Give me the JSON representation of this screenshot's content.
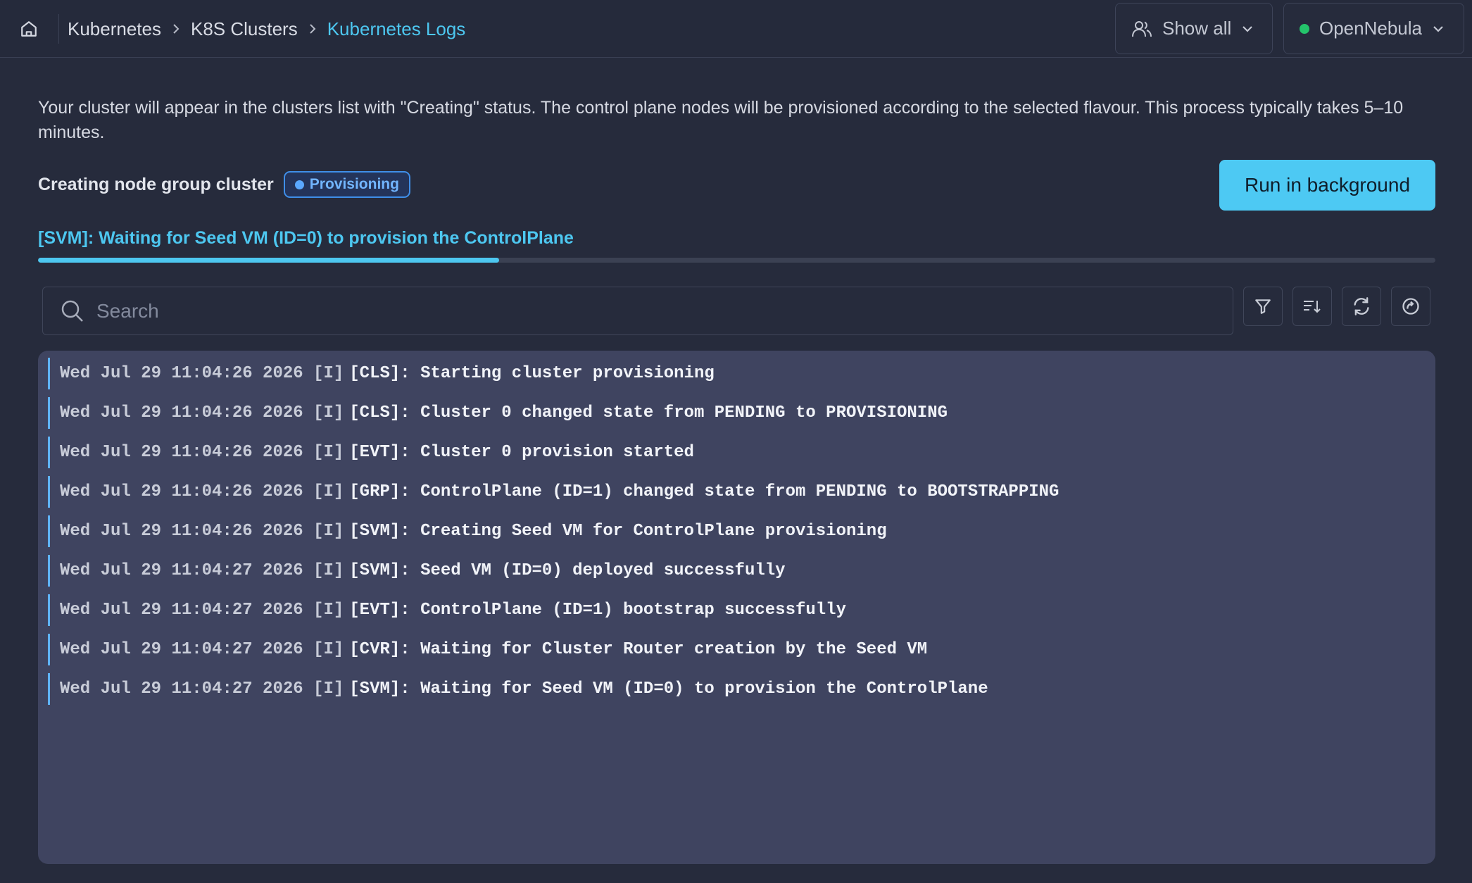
{
  "header": {
    "breadcrumb": [
      "Kubernetes",
      "K8S Clusters",
      "Kubernetes Logs"
    ],
    "show_all_label": "Show all",
    "cloud_label": "OpenNebula",
    "cloud_status_color": "#24c46b"
  },
  "main": {
    "intro": "Your cluster will appear in the clusters list with \"Creating\" status. The control plane nodes will be provisioned according to the selected flavour. This process typically takes 5–10 minutes.",
    "title": "Creating node group cluster",
    "badge": "Provisioning",
    "run_button": "Run in background",
    "status_line": "[SVM]: Waiting for Seed VM (ID=0) to provision the ControlPlane",
    "progress_percent": 33
  },
  "search": {
    "placeholder": "Search",
    "value": ""
  },
  "toolbar": [
    "filter-icon",
    "sort-icon",
    "refresh-icon",
    "follow-icon"
  ],
  "logs": [
    {
      "ts": "Wed Jul 29 11:04:26 2026 [I]",
      "msg": "[CLS]: Starting cluster provisioning"
    },
    {
      "ts": "Wed Jul 29 11:04:26 2026 [I]",
      "msg": "[CLS]: Cluster 0 changed state from PENDING to PROVISIONING"
    },
    {
      "ts": "Wed Jul 29 11:04:26 2026 [I]",
      "msg": "[EVT]: Cluster 0 provision started"
    },
    {
      "ts": "Wed Jul 29 11:04:26 2026 [I]",
      "msg": "[GRP]: ControlPlane (ID=1) changed state from PENDING to BOOTSTRAPPING"
    },
    {
      "ts": "Wed Jul 29 11:04:26 2026 [I]",
      "msg": "[SVM]: Creating Seed VM for ControlPlane provisioning"
    },
    {
      "ts": "Wed Jul 29 11:04:27 2026 [I]",
      "msg": "[SVM]: Seed VM (ID=0) deployed successfully"
    },
    {
      "ts": "Wed Jul 29 11:04:27 2026 [I]",
      "msg": "[EVT]: ControlPlane (ID=1) bootstrap successfully"
    },
    {
      "ts": "Wed Jul 29 11:04:27 2026 [I]",
      "msg": "[CVR]: Waiting for Cluster Router creation by the Seed VM"
    },
    {
      "ts": "Wed Jul 29 11:04:27 2026 [I]",
      "msg": "[SVM]: Waiting for Seed VM (ID=0) to provision the ControlPlane"
    }
  ]
}
